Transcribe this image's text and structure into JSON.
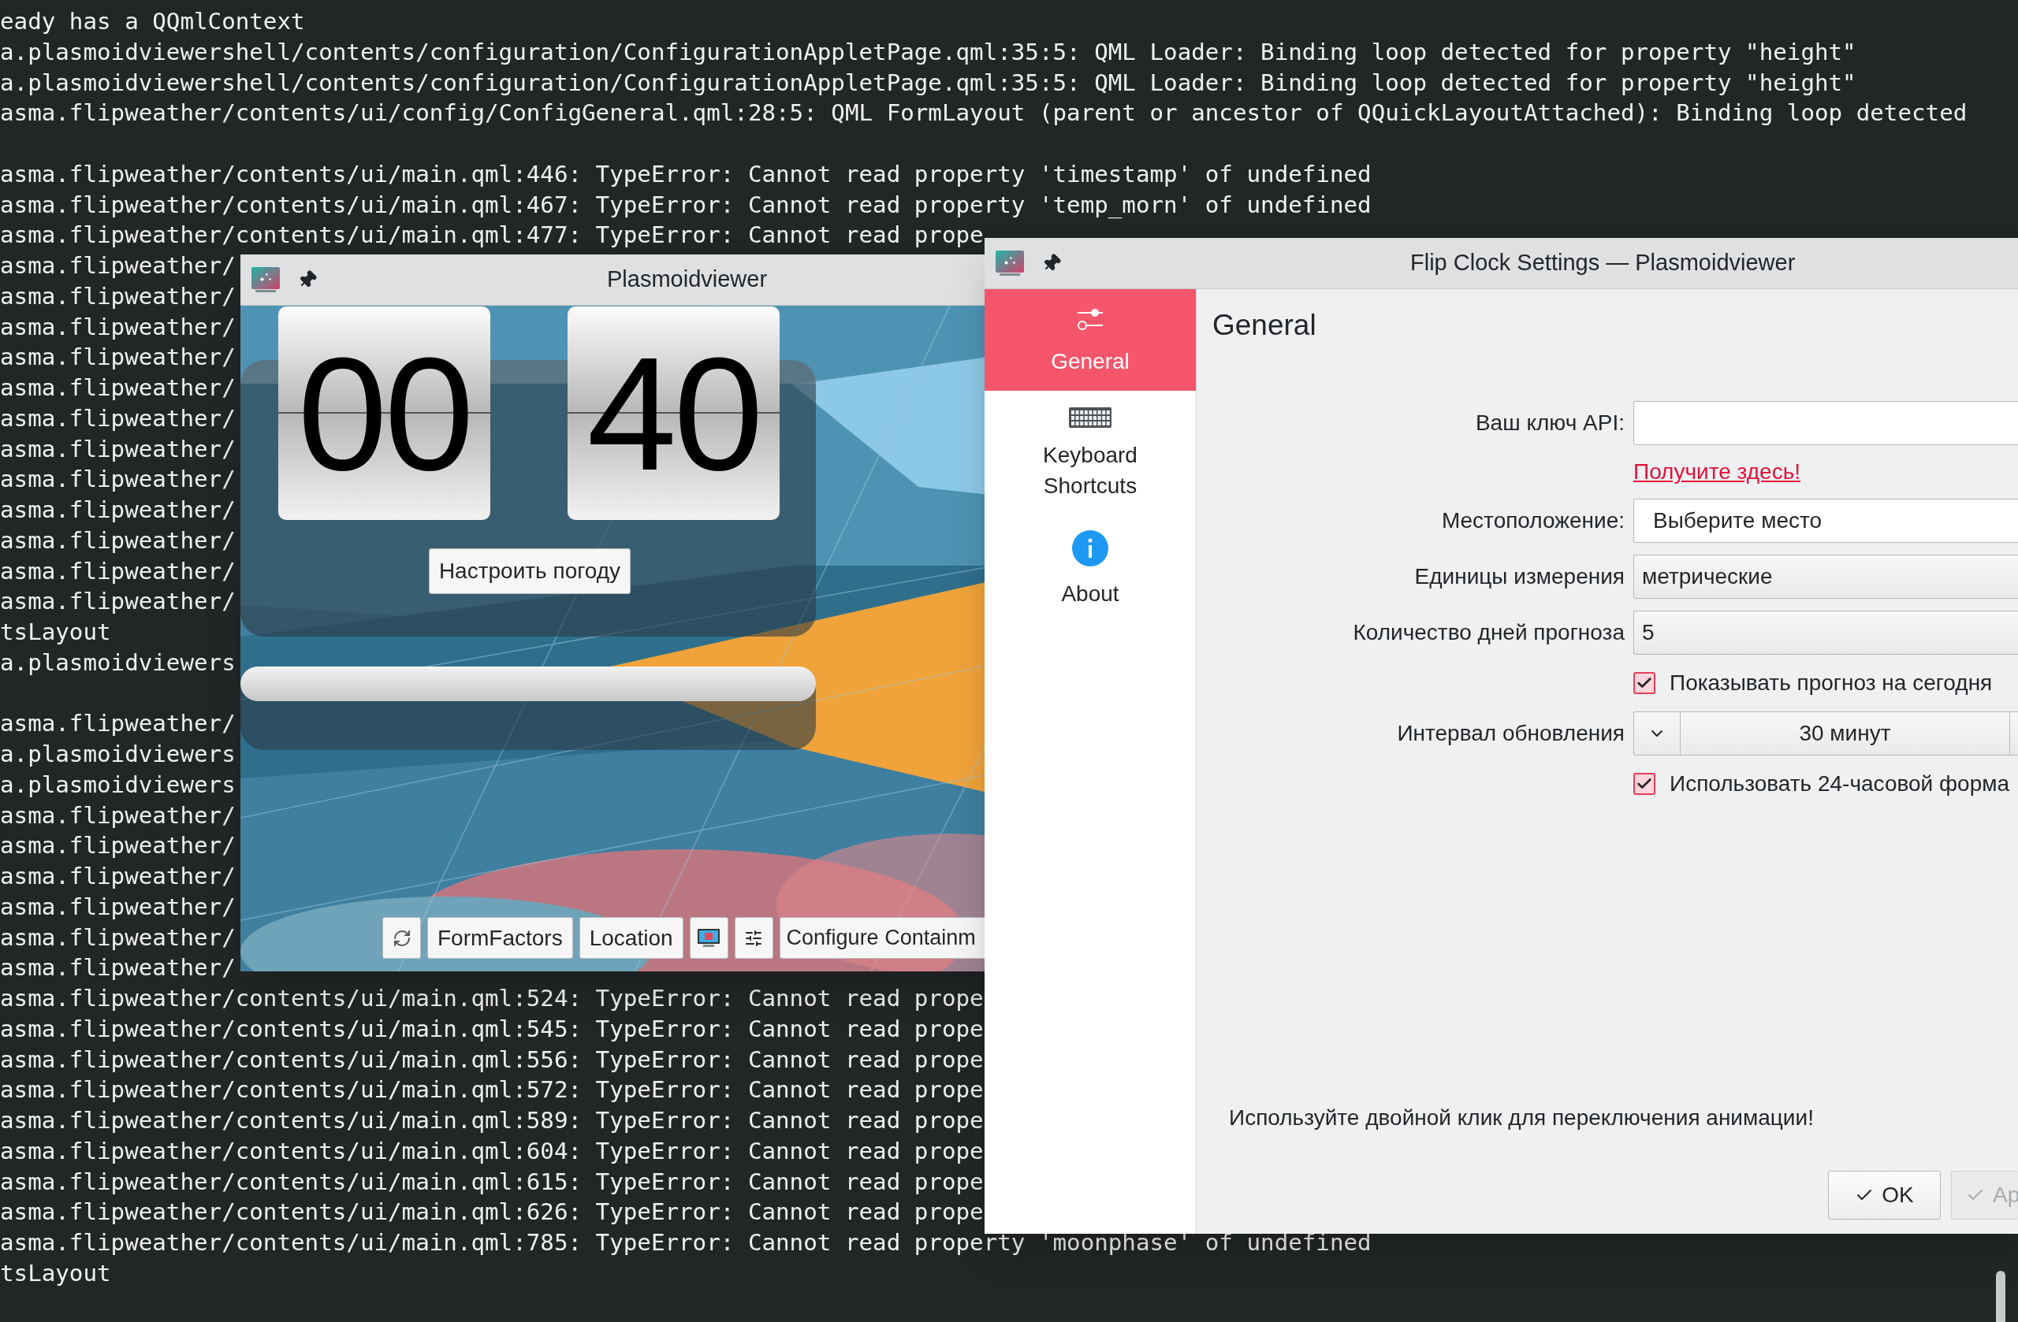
{
  "terminal": {
    "blocks": [
      [
        "eady has a QQmlContext",
        "a.plasmoidviewershell/contents/configuration/ConfigurationAppletPage.qml:35:5: QML Loader: Binding loop detected for property \"height\"",
        "a.plasmoidviewershell/contents/configuration/ConfigurationAppletPage.qml:35:5: QML Loader: Binding loop detected for property \"height\"",
        "asma.flipweather/contents/ui/config/ConfigGeneral.qml:28:5: QML FormLayout (parent or ancestor of QQuickLayoutAttached): Binding loop detected"
      ],
      [
        "asma.flipweather/contents/ui/main.qml:446: TypeError: Cannot read property 'timestamp' of undefined",
        "asma.flipweather/contents/ui/main.qml:467: TypeError: Cannot read property 'temp_morn' of undefined",
        "asma.flipweather/contents/ui/main.qml:477: TypeError: Cannot read prope",
        "asma.flipweather/",
        "asma.flipweather/",
        "asma.flipweather/",
        "asma.flipweather/",
        "asma.flipweather/",
        "asma.flipweather/",
        "asma.flipweather/",
        "asma.flipweather/",
        "asma.flipweather/",
        "asma.flipweather/",
        "asma.flipweather/",
        "asma.flipweather/",
        "tsLayout",
        "a.plasmoidviewers"
      ],
      [
        "asma.flipweather/",
        "a.plasmoidviewers",
        "a.plasmoidviewers",
        "asma.flipweather/",
        "asma.flipweather/",
        "asma.flipweather/",
        "asma.flipweather/",
        "asma.flipweather/",
        "asma.flipweather/",
        "asma.flipweather/contents/ui/main.qml:524: TypeError: Cannot read prope",
        "asma.flipweather/contents/ui/main.qml:545: TypeError: Cannot read prope",
        "asma.flipweather/contents/ui/main.qml:556: TypeError: Cannot read prope",
        "asma.flipweather/contents/ui/main.qml:572: TypeError: Cannot read prope",
        "asma.flipweather/contents/ui/main.qml:589: TypeError: Cannot read prope",
        "asma.flipweather/contents/ui/main.qml:604: TypeError: Cannot read prope",
        "asma.flipweather/contents/ui/main.qml:615: TypeError: Cannot read prope",
        "asma.flipweather/contents/ui/main.qml:626: TypeError: Cannot read prope",
        "asma.flipweather/contents/ui/main.qml:785: TypeError: Cannot read property 'moonphase' of undefined",
        "tsLayout"
      ]
    ]
  },
  "plasmoidviewer": {
    "title": "Plasmoidviewer",
    "clock": {
      "hours": "00",
      "minutes": "40",
      "button": "Настроить погоду"
    },
    "toolbar": [
      {
        "kind": "icon"
      },
      {
        "kind": "text",
        "label": "FormFactors"
      },
      {
        "kind": "text",
        "label": "Location"
      },
      {
        "kind": "icon"
      },
      {
        "kind": "icon"
      },
      {
        "kind": "text",
        "label": "Configure Containm"
      }
    ]
  },
  "settings": {
    "title": "Flip Clock Settings — Plasmoidviewer",
    "sidebar": [
      {
        "label": "General",
        "selected": true
      },
      {
        "label": "Keyboard Shortcuts",
        "selected": false
      },
      {
        "label": "About",
        "selected": false
      }
    ],
    "page_title": "General",
    "form": [
      {
        "kind": "text",
        "label": "Ваш ключ API:"
      },
      {
        "kind": "link",
        "text": "Получите здесь!"
      },
      {
        "kind": "text",
        "label": "Местоположение:",
        "value": "Выберите место"
      },
      {
        "kind": "combo",
        "label": "Единицы измерения",
        "value": "метрические"
      },
      {
        "kind": "spin",
        "label": "Количество дней прогноза",
        "value": "5"
      },
      {
        "kind": "checkbox",
        "text": "Показывать прогноз на сегодня",
        "checked": true
      },
      {
        "kind": "stepper",
        "label": "Интервал обновления",
        "value": "30 минут"
      },
      {
        "kind": "checkbox",
        "text": "Использовать 24-часовой форма",
        "checked": true
      }
    ],
    "hint": "Используйте двойной клик для переключения анимации!",
    "buttons": [
      {
        "label": "OK",
        "disabled": false
      },
      {
        "label": "Ap",
        "disabled": true
      }
    ]
  }
}
